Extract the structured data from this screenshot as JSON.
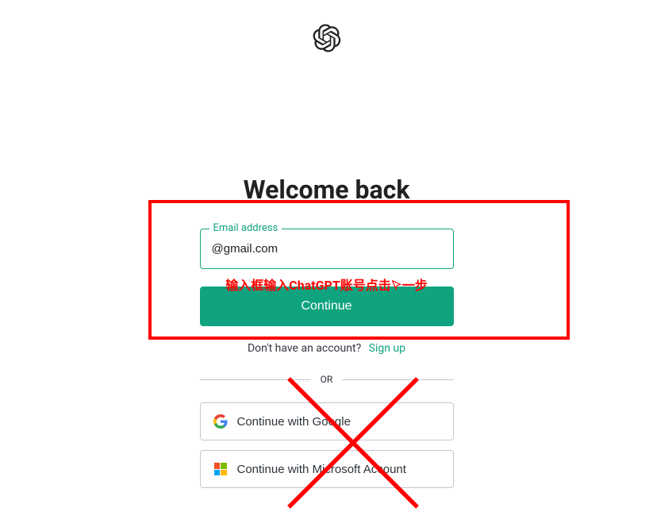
{
  "heading": "Welcome back",
  "email": {
    "label": "Email address",
    "value_suffix": "@gmail.com"
  },
  "annotation": {
    "part1": "输入框输入ChatGPT账号点击",
    "part2": "一步"
  },
  "buttons": {
    "continue": "Continue",
    "google": "Continue with Google",
    "microsoft": "Continue with Microsoft Account"
  },
  "signup": {
    "prompt": "Don't have an account?",
    "link": "Sign up"
  },
  "divider": "OR"
}
